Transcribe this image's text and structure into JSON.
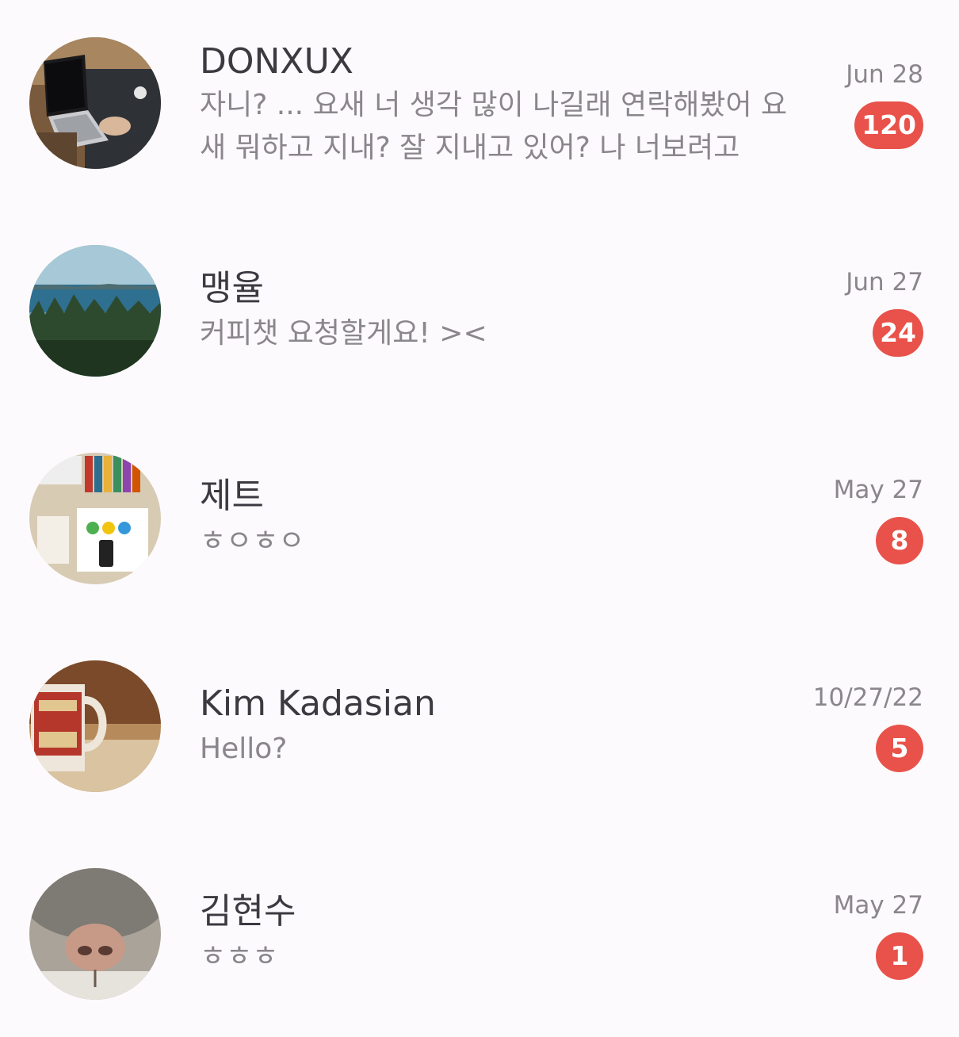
{
  "colors": {
    "background": "#fcfafc",
    "name_text": "#3c3a40",
    "secondary_text": "#8a868c",
    "badge": "#e8524a",
    "badge_text": "#ffffff"
  },
  "chats": [
    {
      "name": "DONXUX",
      "preview": "자니? ... 요새 너 생각 많이 나길래 연락해봤어 요새 뭐하고 지내? 잘 지내고 있어? 나 너보려고",
      "date": "Jun 28",
      "unread": "120",
      "avatar_icon": "laptop-work-photo"
    },
    {
      "name": "맹율",
      "preview": "커피챗 요청할게요! ><",
      "date": "Jun 27",
      "unread": "24",
      "avatar_icon": "forest-sea-photo"
    },
    {
      "name": "제트",
      "preview": "ㅎㅇㅎㅇ",
      "date": "May 27",
      "unread": "8",
      "avatar_icon": "desk-books-photo"
    },
    {
      "name": "Kim Kadasian",
      "preview": "Hello?",
      "date": "10/27/22",
      "unread": "5",
      "avatar_icon": "coffee-mug-photo"
    },
    {
      "name": "김현수",
      "preview": "ㅎㅎㅎ",
      "date": "May 27",
      "unread": "1",
      "avatar_icon": "cat-nose-photo"
    }
  ]
}
